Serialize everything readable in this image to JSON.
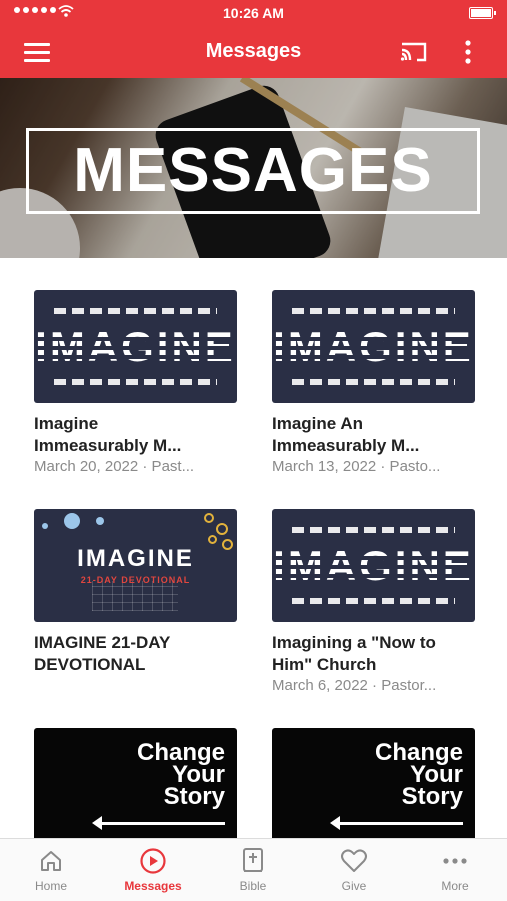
{
  "status": {
    "time": "10:26 AM"
  },
  "header": {
    "title": "Messages"
  },
  "hero": {
    "title": "MESSAGES"
  },
  "messages": [
    {
      "thumb": "imagine",
      "title": "Imagine",
      "title2": "Immeasurably M...",
      "sub": "March 20, 2022 · Past..."
    },
    {
      "thumb": "imagine",
      "title": "Imagine An",
      "title2": "Immeasurably M...",
      "sub": "March 13, 2022 · Pasto..."
    },
    {
      "thumb": "devotional",
      "thumb_title": "IMAGINE",
      "thumb_sub": "21-DAY DEVOTIONAL",
      "title": "IMAGINE 21-DAY",
      "title2": "DEVOTIONAL",
      "sub": ""
    },
    {
      "thumb": "imagine",
      "title": "Imagining a \"Now to",
      "title2": "Him\" Church",
      "sub": "March 6, 2022 · Pastor..."
    },
    {
      "thumb": "change",
      "thumb_text": [
        "Change",
        "Your",
        "Story"
      ]
    },
    {
      "thumb": "change",
      "thumb_text": [
        "Change",
        "Your",
        "Story"
      ]
    }
  ],
  "imagine_word": "IMAGINE",
  "tabs": [
    {
      "label": "Home",
      "icon": "home-icon"
    },
    {
      "label": "Messages",
      "icon": "play-circle-icon",
      "active": true
    },
    {
      "label": "Bible",
      "icon": "bible-icon"
    },
    {
      "label": "Give",
      "icon": "heart-icon"
    },
    {
      "label": "More",
      "icon": "more-dots-icon"
    }
  ],
  "colors": {
    "brand": "#e8373c",
    "thumb_bg": "#2a2f45",
    "muted": "#8a8a8a"
  }
}
